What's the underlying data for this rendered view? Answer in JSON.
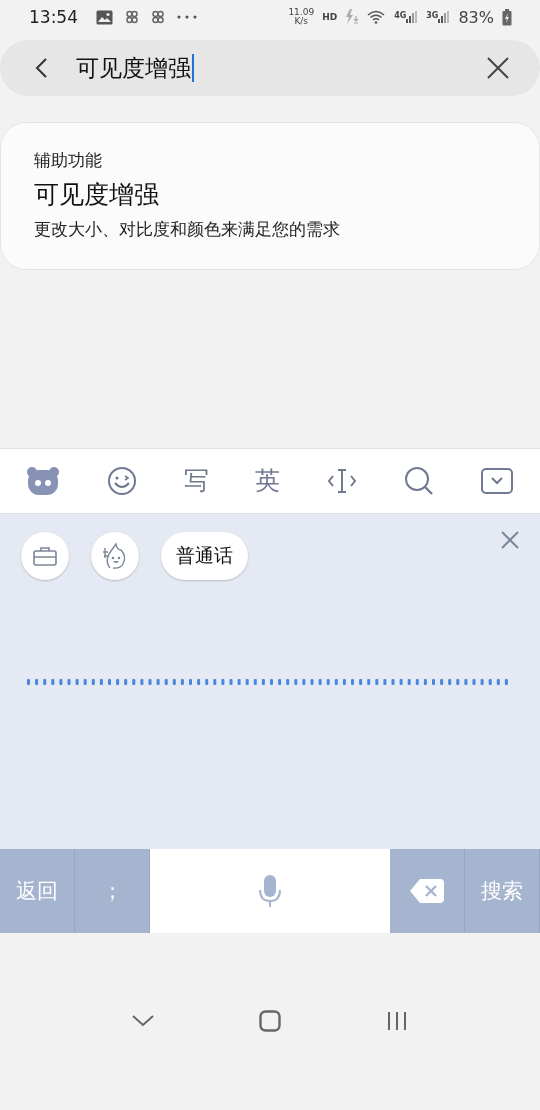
{
  "status_bar": {
    "time": "13:54",
    "net_speed": {
      "value": "11.09",
      "unit": "K/s"
    },
    "hd": "HD",
    "networks": [
      "4G",
      "3G"
    ],
    "battery": "83%"
  },
  "search": {
    "value": "可见度增强"
  },
  "result": {
    "category": "辅助功能",
    "title": "可见度增强",
    "description": "更改大小、对比度和颜色来满足您的需求"
  },
  "keyboard_toolbar": [
    {
      "kind": "logo"
    },
    {
      "kind": "emoji"
    },
    {
      "kind": "text",
      "label": "写"
    },
    {
      "kind": "text",
      "label": "英"
    },
    {
      "kind": "cursor"
    },
    {
      "kind": "search"
    },
    {
      "kind": "collapse"
    }
  ],
  "voice_panel": {
    "chips": [
      {
        "kind": "toolbox"
      },
      {
        "kind": "sticker"
      },
      {
        "kind": "text",
        "label": "普通话"
      }
    ]
  },
  "keys": [
    {
      "kind": "text",
      "label": "返回"
    },
    {
      "kind": "text",
      "label": "；"
    },
    {
      "kind": "mic"
    },
    {
      "kind": "delete"
    },
    {
      "kind": "text",
      "label": "搜索"
    }
  ]
}
